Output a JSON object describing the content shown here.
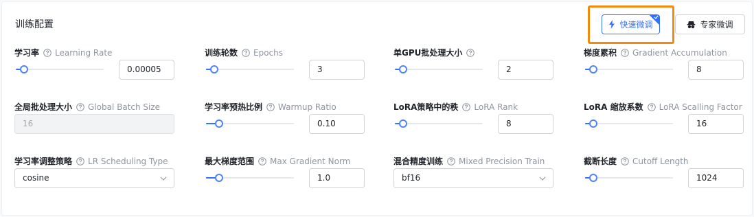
{
  "section": {
    "title": "训练配置"
  },
  "mode_switch": {
    "fast": {
      "label": "快速微调",
      "icon": "lightning-icon"
    },
    "expert": {
      "label": "专家微调",
      "icon": "expert-icon"
    },
    "colors": {
      "highlight": "#f28b0d",
      "accent": "#3370ff"
    }
  },
  "fields": {
    "learning_rate": {
      "label_cn": "学习率",
      "label_en": "Learning Rate",
      "value": "0.00005",
      "slider_level": 0.05
    },
    "epochs": {
      "label_cn": "训练轮数",
      "label_en": "Epochs",
      "value": "3",
      "slider_level": 0.05
    },
    "gpu_batch": {
      "label_cn": "单GPU批处理大小",
      "label_en": "",
      "value": "2",
      "slider_level": 0.05
    },
    "grad_accum": {
      "label_cn": "梯度累积",
      "label_en": "Gradient Accumulation",
      "value": "8",
      "slider_level": 0.05
    },
    "global_batch": {
      "label_cn": "全局批处理大小",
      "label_en": "Global Batch Size",
      "value": "16",
      "disabled": true
    },
    "warmup_ratio": {
      "label_cn": "学习率预热比例",
      "label_en": "Warmup Ratio",
      "value": "0.10",
      "slider_level": 0.1
    },
    "lora_rank": {
      "label_cn": "LoRA策略中的秩",
      "label_en": "LoRA Rank",
      "value": "8",
      "slider_level": 0.05
    },
    "lora_scale": {
      "label_cn": "LoRA 缩放系数",
      "label_en": "LoRA Scalling Factor",
      "value": "16",
      "slider_level": 0.05
    },
    "lr_scheduler": {
      "label_cn": "学习率调整策略",
      "label_en": "LR Scheduling Type",
      "value": "cosine"
    },
    "max_grad_norm": {
      "label_cn": "最大梯度范围",
      "label_en": "Max Gradient Norm",
      "value": "1.0",
      "slider_level": 0.1
    },
    "mixed_precision": {
      "label_cn": "混合精度训练",
      "label_en": "Mixed Precision Train",
      "value": "bf16"
    },
    "cutoff_length": {
      "label_cn": "截断长度",
      "label_en": "Cutoff Length",
      "value": "1024",
      "slider_level": 0.05
    }
  }
}
